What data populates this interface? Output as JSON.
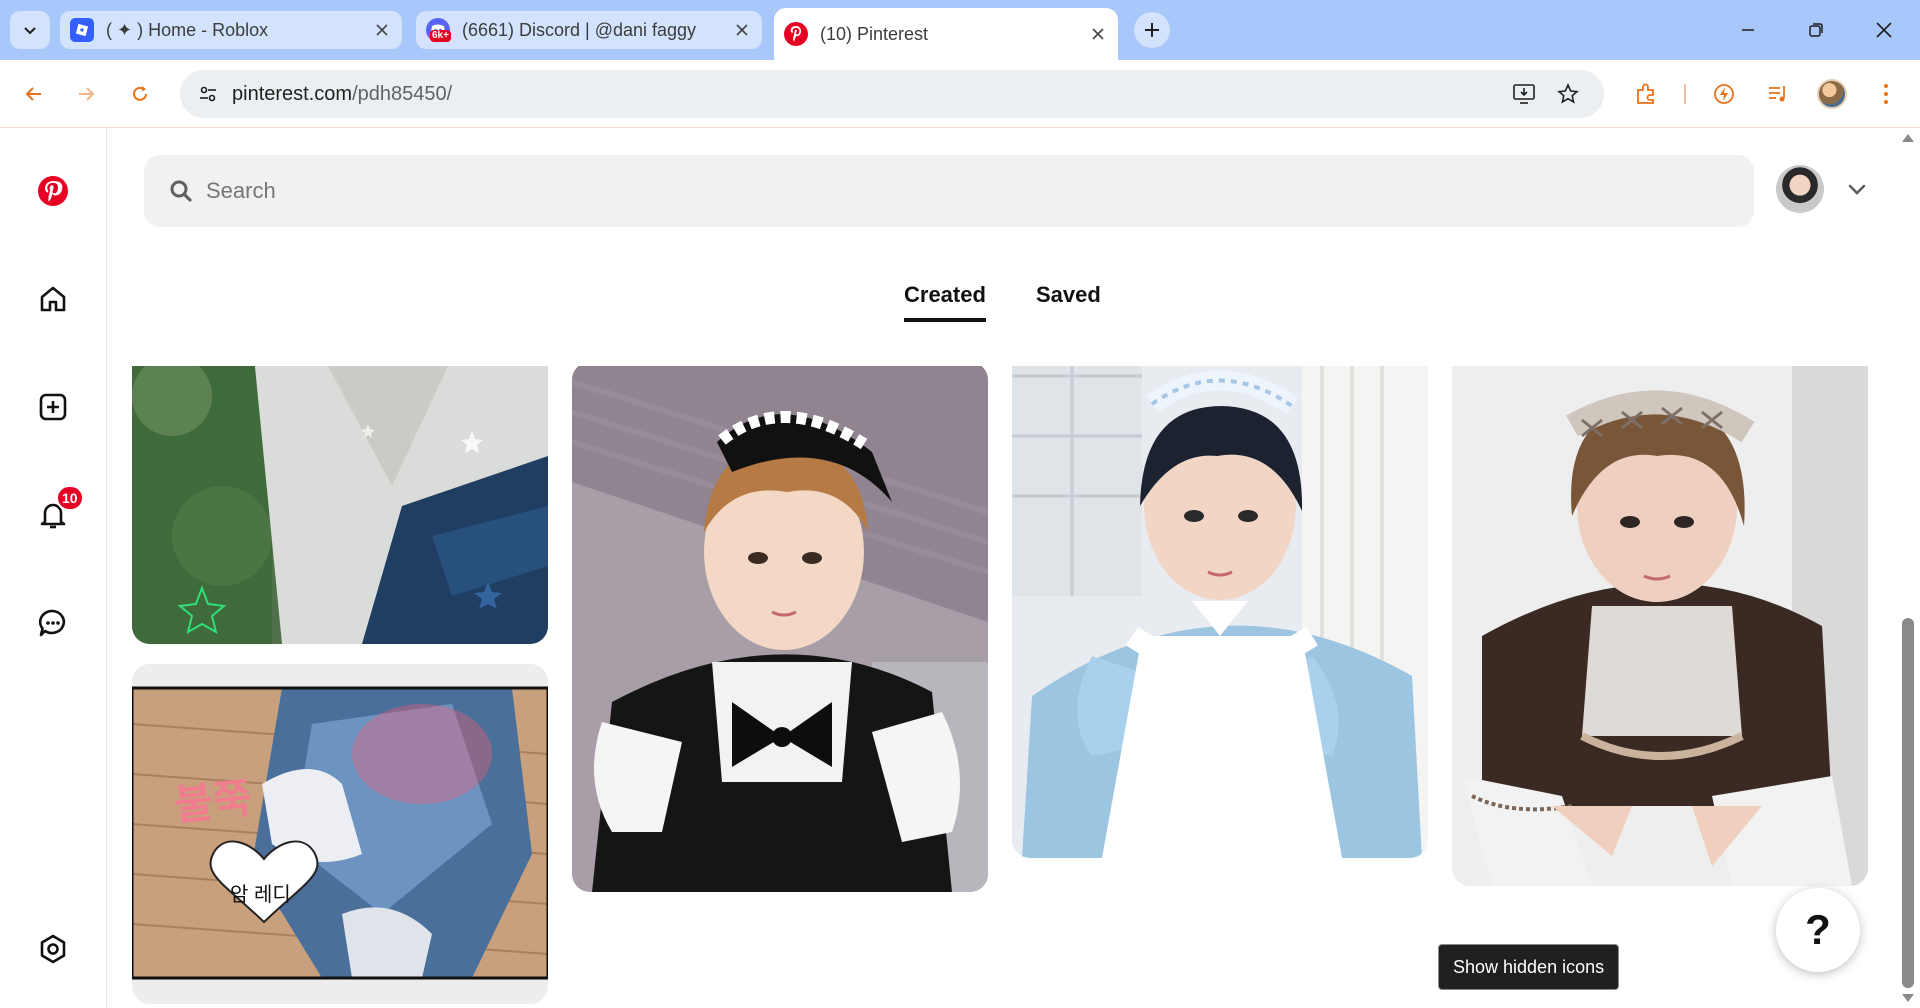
{
  "browser": {
    "tabs": [
      {
        "title": "( ✦ ) Home - Roblox",
        "favicon": "roblox-icon",
        "active": false
      },
      {
        "title": "(6661) Discord | @dani faggy",
        "favicon": "discord-icon",
        "badge": "6k+",
        "active": false
      },
      {
        "title": "(10) Pinterest",
        "favicon": "pinterest-icon",
        "active": true
      }
    ],
    "url_host": "pinterest.com",
    "url_path": "/pdh85450/",
    "accent_color": "#a8c7fa"
  },
  "sidebar": {
    "items": [
      {
        "name": "pinterest-logo",
        "icon": "pinterest-icon"
      },
      {
        "name": "home",
        "icon": "home-icon"
      },
      {
        "name": "create",
        "icon": "plus-square-icon"
      },
      {
        "name": "notifications",
        "icon": "bell-icon",
        "badge": "10"
      },
      {
        "name": "messages",
        "icon": "chat-icon"
      },
      {
        "name": "settings",
        "icon": "gear-icon"
      }
    ]
  },
  "search": {
    "placeholder": "Search"
  },
  "profile_tabs": [
    {
      "label": "Created",
      "active": true
    },
    {
      "label": "Saved",
      "active": false
    }
  ],
  "pins": [
    {
      "description": "kimono photo with stars"
    },
    {
      "description": "manhwa panel",
      "text": "암 레디",
      "text2": "불쭉"
    },
    {
      "description": "black maid outfit"
    },
    {
      "description": "blue maid outfit"
    },
    {
      "description": "brown maid outfit"
    }
  ],
  "help": {
    "label": "?"
  },
  "tooltip": {
    "text": "Show hidden icons"
  },
  "brand_color": "#e60023"
}
